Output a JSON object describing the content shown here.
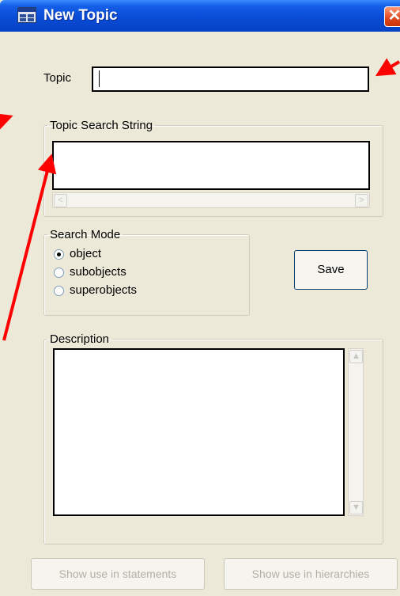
{
  "window": {
    "title": "New Topic",
    "close_symbol": "✕",
    "app_icon": "app-window-icon"
  },
  "topic": {
    "label": "Topic",
    "value": ""
  },
  "search_string": {
    "legend": "Topic Search String",
    "value": "",
    "scroll_left": "<",
    "scroll_right": ">"
  },
  "search_mode": {
    "legend": "Search Mode",
    "options": [
      {
        "label": "object",
        "checked": true
      },
      {
        "label": "subobjects",
        "checked": false
      },
      {
        "label": "superobjects",
        "checked": false
      }
    ]
  },
  "save_label": "Save",
  "description": {
    "legend": "Description",
    "value": "",
    "scroll_up": "▲",
    "scroll_down": "▼"
  },
  "buttons": {
    "statements": "Show use in statements",
    "hierarchies": "Show use in hierarchies"
  },
  "colors": {
    "titlebar": "#0a4bd6",
    "dialog_bg": "#ece9d8",
    "annotation_arrow": "#ff0000"
  }
}
